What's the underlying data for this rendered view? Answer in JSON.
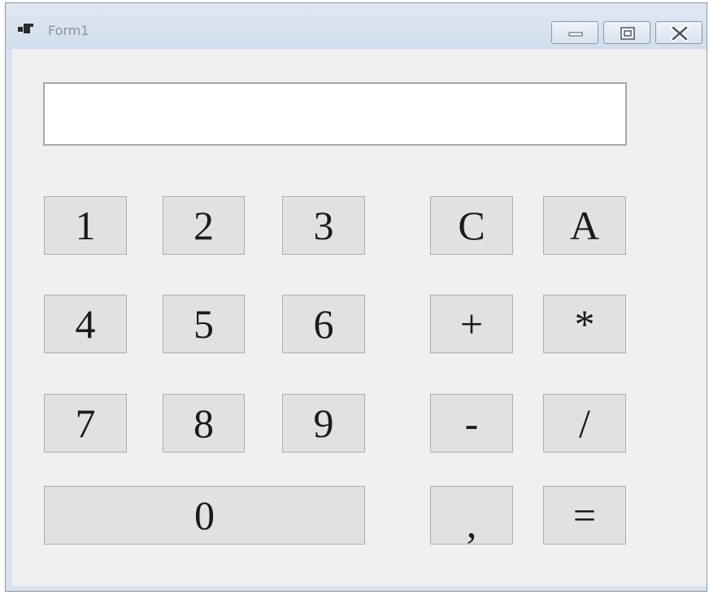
{
  "window": {
    "title": "Form1",
    "minimize_icon": "minimize-icon",
    "maximize_icon": "maximize-icon",
    "close_icon": "close-icon"
  },
  "display": {
    "value": ""
  },
  "keys": {
    "k1": "1",
    "k2": "2",
    "k3": "3",
    "clear": "C",
    "all_clear": "A",
    "k4": "4",
    "k5": "5",
    "k6": "6",
    "plus": "+",
    "multiply": "*",
    "k7": "7",
    "k8": "8",
    "k9": "9",
    "minus": "-",
    "divide": "/",
    "k0": "0",
    "comma": ",",
    "equals": "="
  }
}
